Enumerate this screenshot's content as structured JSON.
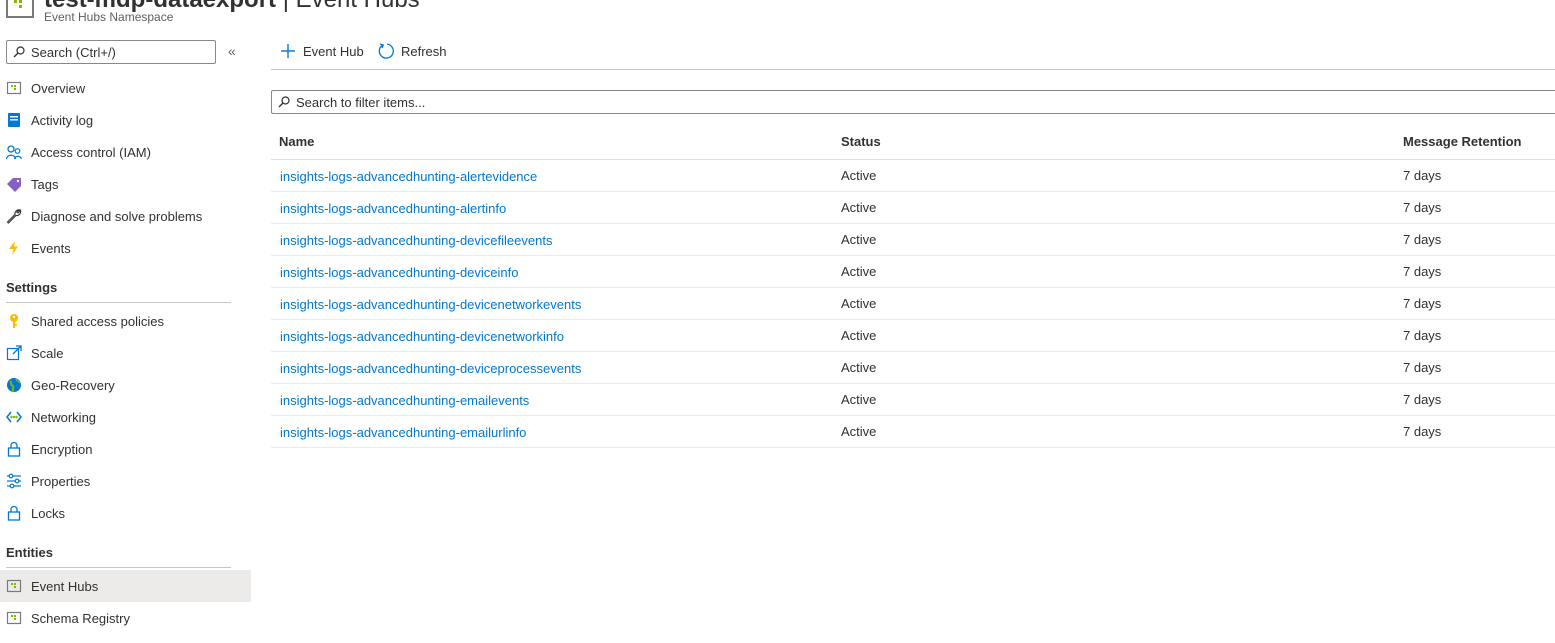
{
  "header": {
    "title_prefix": "test-mdp-dataexport",
    "title_separator": " | ",
    "title_page": "Event Hubs",
    "subtitle": "Event Hubs Namespace"
  },
  "sidebar": {
    "search_placeholder": "Search (Ctrl+/)",
    "collapse_glyph": "«",
    "items_top": [
      {
        "label": "Overview",
        "icon": "overview-icon"
      },
      {
        "label": "Activity log",
        "icon": "activity-log-icon"
      },
      {
        "label": "Access control (IAM)",
        "icon": "people-icon"
      },
      {
        "label": "Tags",
        "icon": "tag-icon"
      },
      {
        "label": "Diagnose and solve problems",
        "icon": "wrench-icon"
      },
      {
        "label": "Events",
        "icon": "lightning-icon"
      }
    ],
    "settings_heading": "Settings",
    "items_settings": [
      {
        "label": "Shared access policies",
        "icon": "key-icon"
      },
      {
        "label": "Scale",
        "icon": "scale-icon"
      },
      {
        "label": "Geo-Recovery",
        "icon": "globe-icon"
      },
      {
        "label": "Networking",
        "icon": "networking-icon"
      },
      {
        "label": "Encryption",
        "icon": "lock-icon"
      },
      {
        "label": "Properties",
        "icon": "properties-icon"
      },
      {
        "label": "Locks",
        "icon": "lock-icon"
      }
    ],
    "entities_heading": "Entities",
    "items_entities": [
      {
        "label": "Event Hubs",
        "icon": "event-hubs-icon",
        "selected": true
      },
      {
        "label": "Schema Registry",
        "icon": "schema-registry-icon"
      }
    ]
  },
  "toolbar": {
    "add_label": "Event Hub",
    "refresh_label": "Refresh"
  },
  "filter": {
    "placeholder": "Search to filter items..."
  },
  "table": {
    "headers": {
      "name": "Name",
      "status": "Status",
      "retention": "Message Retention"
    },
    "rows": [
      {
        "name": "insights-logs-advancedhunting-alertevidence",
        "status": "Active",
        "retention": "7 days"
      },
      {
        "name": "insights-logs-advancedhunting-alertinfo",
        "status": "Active",
        "retention": "7 days"
      },
      {
        "name": "insights-logs-advancedhunting-devicefileevents",
        "status": "Active",
        "retention": "7 days"
      },
      {
        "name": "insights-logs-advancedhunting-deviceinfo",
        "status": "Active",
        "retention": "7 days"
      },
      {
        "name": "insights-logs-advancedhunting-devicenetworkevents",
        "status": "Active",
        "retention": "7 days"
      },
      {
        "name": "insights-logs-advancedhunting-devicenetworkinfo",
        "status": "Active",
        "retention": "7 days"
      },
      {
        "name": "insights-logs-advancedhunting-deviceprocessevents",
        "status": "Active",
        "retention": "7 days"
      },
      {
        "name": "insights-logs-advancedhunting-emailevents",
        "status": "Active",
        "retention": "7 days"
      },
      {
        "name": "insights-logs-advancedhunting-emailurlinfo",
        "status": "Active",
        "retention": "7 days"
      }
    ]
  },
  "colors": {
    "link": "#0078d4",
    "selected_bg": "#edebe9",
    "text": "#323130"
  }
}
